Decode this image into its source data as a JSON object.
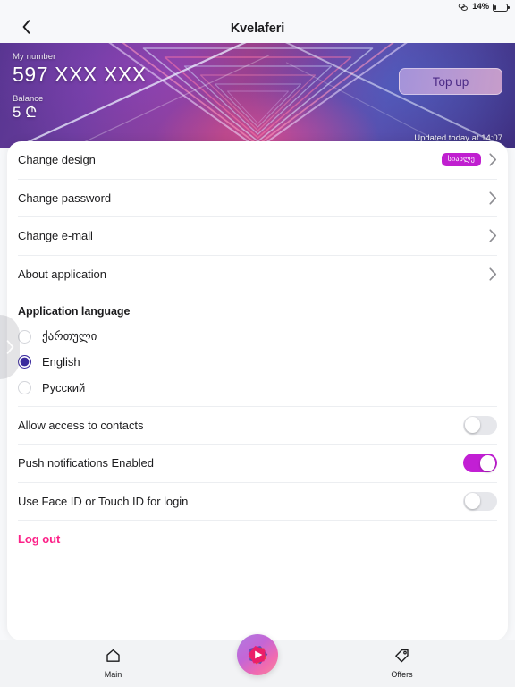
{
  "status_bar": {
    "cast_icon": "link-icon",
    "battery_percent": "14%",
    "battery_level": 14
  },
  "nav": {
    "back_icon": "chevron-left-icon",
    "title": "Kvelaferi"
  },
  "banner": {
    "my_number_label": "My number",
    "my_number_value": "597 XXX XXX",
    "balance_label": "Balance",
    "balance_value": "5 ₾",
    "topup_label": "Top up",
    "updated_text": "Updated today at 14:07"
  },
  "settings": {
    "rows": [
      {
        "label": "Change design",
        "badge": "სიახლე",
        "chevron": "chevron-right-icon"
      },
      {
        "label": "Change password",
        "badge": null,
        "chevron": "chevron-right-icon"
      },
      {
        "label": "Change e-mail",
        "badge": null,
        "chevron": "chevron-right-icon"
      },
      {
        "label": "About application",
        "badge": null,
        "chevron": "chevron-right-icon"
      }
    ],
    "language_section": {
      "title": "Application language",
      "options": [
        {
          "label": "ქართული",
          "selected": false
        },
        {
          "label": "English",
          "selected": true
        },
        {
          "label": "Русский",
          "selected": false
        }
      ]
    },
    "toggles": [
      {
        "label": "Allow access to contacts",
        "on": false
      },
      {
        "label": "Push notifications Enabled",
        "on": true
      },
      {
        "label": "Use Face ID or Touch ID for login",
        "on": false
      }
    ],
    "logout_label": "Log out"
  },
  "drawer_handle": {
    "icon": "chevron-right-icon"
  },
  "bottom_nav": {
    "tabs": [
      {
        "label": "Main",
        "icon": "home-icon"
      },
      {
        "label": "Offers",
        "icon": "tag-icon"
      }
    ],
    "center_button_icon": "play-logo-icon"
  },
  "colors": {
    "accent_purple": "#c21fd4",
    "badge_purple": "#c01fd0",
    "logout_pink": "#fc2188",
    "radio_selected": "#3b2b9e",
    "sheet_bg": "#ffffff",
    "page_bg": "#f7f8fa",
    "bottom_bar_bg": "#f2f3f5"
  }
}
